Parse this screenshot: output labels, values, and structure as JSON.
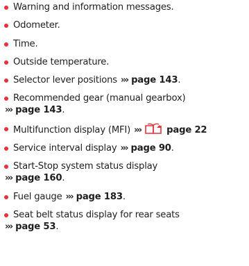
{
  "items": [
    {
      "text": "Warning and information messages.",
      "ref": "",
      "suffix": ""
    },
    {
      "text": "Odometer.",
      "ref": "",
      "suffix": ""
    },
    {
      "text": "Time.",
      "ref": "",
      "suffix": ""
    },
    {
      "text": "Outside temperature.",
      "ref": "",
      "suffix": ""
    },
    {
      "text": "Selector lever positions",
      "ref": "page 143",
      "suffix": "."
    },
    {
      "text": "Recommended gear (manual gearbox)",
      "ref": "page 143",
      "suffix": "."
    },
    {
      "text": "Multifunction display (MFI)",
      "ref": "page 22",
      "suffix": ""
    },
    {
      "text": "Service interval display",
      "ref": "page 90",
      "suffix": "."
    },
    {
      "text": "Start-Stop system status display",
      "ref": "page 160",
      "suffix": "."
    },
    {
      "text": "Fuel gauge",
      "ref": "page 183",
      "suffix": "."
    },
    {
      "text": "Seat belt status display for rear seats",
      "ref": "page 53",
      "suffix": "."
    }
  ],
  "arrow_glyph": "›››",
  "colors": {
    "bullet": "#e6323c",
    "book_icon": "#e6323c",
    "text": "#1f1f1f"
  },
  "icons": {
    "bullet": "bullet-dot-icon",
    "arrows": "triple-chevron-arrow-icon",
    "book": "open-book-reference-icon"
  }
}
